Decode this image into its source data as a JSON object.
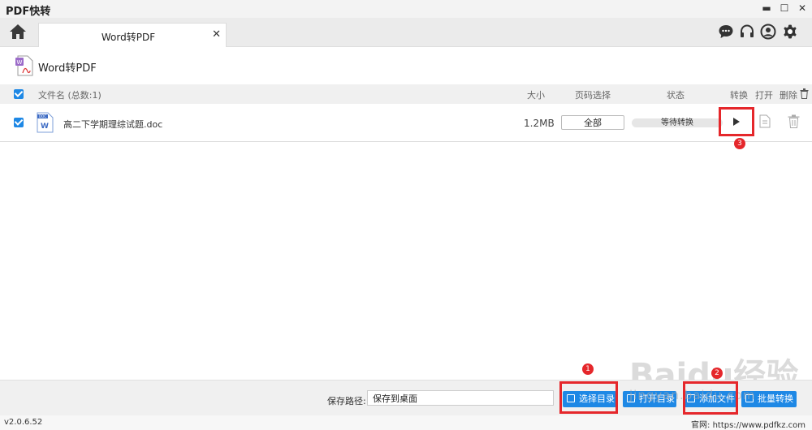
{
  "app": {
    "title": "PDF快转",
    "window_controls": {
      "minimize": "▬",
      "maximize": "☐",
      "close": "✕"
    }
  },
  "tabs": [
    {
      "label": "Word转PDF",
      "close": "✕",
      "active": true
    }
  ],
  "toolbar": {
    "icons": [
      "chat-icon",
      "headset-icon",
      "user-icon",
      "gear-icon"
    ]
  },
  "section": {
    "title": "Word转PDF"
  },
  "table": {
    "columns": {
      "filename": "文件名 (总数:1)",
      "size": "大小",
      "page_select": "页码选择",
      "status": "状态",
      "convert": "转换",
      "open": "打开",
      "delete": "删除"
    },
    "rows": [
      {
        "filename": "高二下学期理综试题.doc",
        "size": "1.2MB",
        "page_select": "全部",
        "status": "等待转换",
        "checked": true
      }
    ]
  },
  "annotations": {
    "m1": "1",
    "m2": "2",
    "m3": "3",
    "color": "#e5272b"
  },
  "footer": {
    "save_path_label": "保存路径:",
    "save_path_value": "保存到桌面",
    "buttons": {
      "select_dir": "选择目录",
      "open_dir": "打开目录",
      "add_file": "添加文件",
      "batch_convert": "批量转换"
    }
  },
  "statusbar": {
    "version": "v2.0.6.52",
    "website": "官网: https://www.pdfkz.com"
  },
  "watermark": {
    "main": "Baidu经验",
    "sub": "jingyan.baidu.com"
  },
  "colors": {
    "accent": "#1e88e5",
    "highlight": "#e5272b",
    "file_icon": "#3d6bc4",
    "logo": "#9b6bc9"
  }
}
